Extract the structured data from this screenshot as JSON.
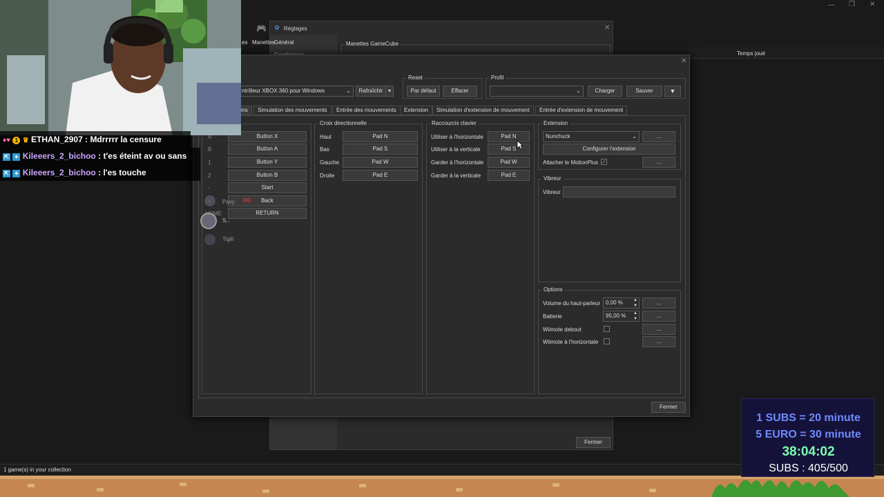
{
  "background_window": {
    "status_text": "1 game(s) in your collection",
    "column_time_played": "Temps joué"
  },
  "settings_window": {
    "title": "Réglages",
    "sidebar": [
      "Général",
      "Graphismes"
    ],
    "partial_tab": "Manettes",
    "partial_tab_left": "es",
    "gamecube_group": "Manettes GameCube",
    "close_button": "Fermer"
  },
  "controller_dialog": {
    "device_select": "ntrôleur XBOX 360 pour Windows",
    "refresh_button": "Rafraîchir",
    "reset_group": "Reset",
    "default_button": "Par défaut",
    "clear_button": "Effacer",
    "profile_group": "Profil",
    "profile_value": "",
    "load_button": "Charger",
    "save_button": "Sauver",
    "tabs": [
      "ons",
      "Simulation des mouvements",
      "Entrée des mouvements",
      "Extension",
      "Simulation d'extension de mouvement",
      "Entrée d'extension de mouvement"
    ],
    "buttons_group": {
      "labels": [
        "A",
        "B",
        "1",
        "2",
        "-",
        "+",
        "HOME"
      ],
      "bindings": [
        "Button X",
        "Button A",
        "Button Y",
        "Button B",
        "Start",
        "Back",
        "RETURN"
      ]
    },
    "dpad_group": {
      "title": "Croix directionnelle",
      "rows": [
        {
          "label": "Haut",
          "value": "Pad N"
        },
        {
          "label": "Bas",
          "value": "Pad S"
        },
        {
          "label": "Gauche",
          "value": "Pad W"
        },
        {
          "label": "Droite",
          "value": "Pad E"
        }
      ]
    },
    "hotkeys_group": {
      "title": "Raccourcis clavier",
      "rows": [
        {
          "label": "Utiliser à l'horizontale",
          "value": "Pad N"
        },
        {
          "label": "Utiliser à la verticale",
          "value": "Pad S"
        },
        {
          "label": "Garder à l'horizontale",
          "value": "Pad W"
        },
        {
          "label": "Garder à la verticale",
          "value": "Pad E"
        }
      ]
    },
    "extension_group": {
      "title": "Extension",
      "select": "Nunchuck",
      "more": "...",
      "configure_button": "Configurer l'extension",
      "motionplus_label": "Attacher le MotionPlus",
      "motionplus_checked": true
    },
    "rumble_group": {
      "title": "Vibreur",
      "label": "Vibreur",
      "value": ""
    },
    "options_group": {
      "title": "Options",
      "speaker_label": "Volume du haut-parleur",
      "speaker_value": "0,00 %",
      "battery_label": "Batterie",
      "battery_value": "95,00 %",
      "upright_label": "Wiimote debout",
      "sideways_label": "Wiimote à l'horizontale",
      "more": "..."
    },
    "close_button": "Fermer"
  },
  "chat": [
    {
      "user": "ETHAN_2907",
      "message": "Mdrrrrr la censure",
      "color": "#ffffff"
    },
    {
      "user": "Kileeers_2_bichoo",
      "message": "t'es éteint av ou sans",
      "color": "#c9a6ff"
    },
    {
      "user": "Kileeers_2_bichoo",
      "message": "l'es touche",
      "color": "#c9a6ff"
    }
  ],
  "stream_overlay": {
    "line1": "1 SUBS = 20 minute",
    "line2": "5 EURO = 30 minute",
    "timer": "38:04:02",
    "subs": "SUBS : 405/500"
  },
  "overlay_names": [
    "Pavy",
    "OG",
    "S...",
    "Tigill"
  ],
  "colors": {
    "overlay_blue": "#6e8bff",
    "overlay_green": "#7dffb0",
    "overlay_bg": "#15123a"
  }
}
